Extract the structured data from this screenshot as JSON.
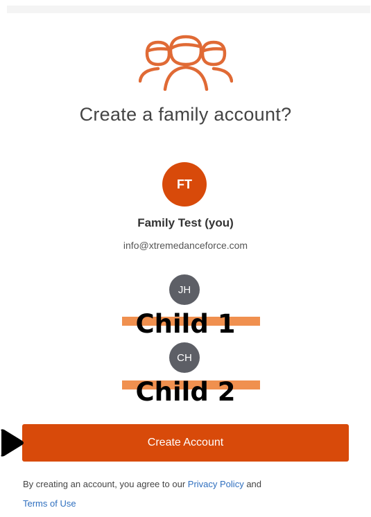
{
  "header": {
    "title": "Create a family account?"
  },
  "parent": {
    "initials": "FT",
    "name": "Family Test (you)",
    "email": "info@xtremedanceforce.com"
  },
  "children": [
    {
      "initials": "JH",
      "label": "Child 1"
    },
    {
      "initials": "CH",
      "label": "Child 2"
    }
  ],
  "actions": {
    "create_label": "Create Account"
  },
  "terms": {
    "prefix": "By creating an account, you agree to our",
    "privacy_label": "Privacy Policy",
    "and": "and",
    "terms_label": "Terms of Use"
  },
  "icons": {
    "family": "family-icon",
    "pointer": "pointer-arrow-icon"
  },
  "colors": {
    "accent": "#d84a0a",
    "avatar_gray": "#5d5f66",
    "link": "#2f6fbf",
    "redaction": "#f0904f"
  }
}
